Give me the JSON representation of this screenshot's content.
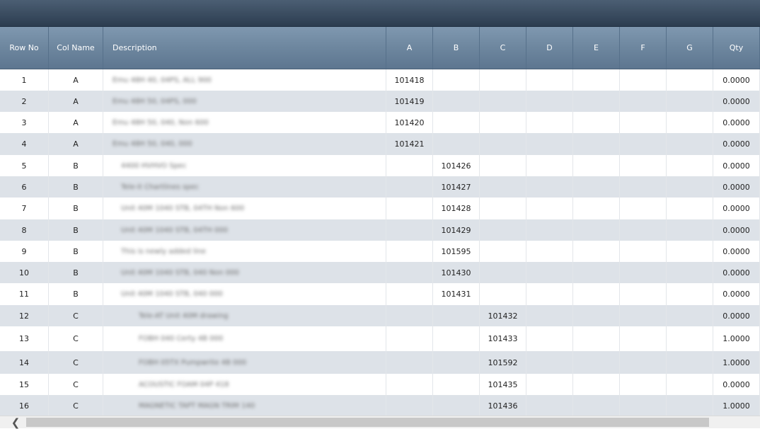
{
  "grid": {
    "columns": [
      {
        "key": "row_no",
        "label": "Row No"
      },
      {
        "key": "col_name",
        "label": "Col Name"
      },
      {
        "key": "description",
        "label": "Description"
      },
      {
        "key": "a",
        "label": "A"
      },
      {
        "key": "b",
        "label": "B"
      },
      {
        "key": "c",
        "label": "C"
      },
      {
        "key": "d",
        "label": "D"
      },
      {
        "key": "e",
        "label": "E"
      },
      {
        "key": "f",
        "label": "F"
      },
      {
        "key": "g",
        "label": "G"
      },
      {
        "key": "qty",
        "label": "Qty"
      }
    ],
    "rows": [
      {
        "row_no": "1",
        "col_name": "A",
        "description": "Emu 48H 40, 04PS, ALL 900",
        "a": "101418",
        "b": "",
        "c": "",
        "qty": "0.0000"
      },
      {
        "row_no": "2",
        "col_name": "A",
        "description": "Emu 48H 50, 04PS, 000",
        "a": "101419",
        "b": "",
        "c": "",
        "qty": "0.0000"
      },
      {
        "row_no": "3",
        "col_name": "A",
        "description": "Emu 48H 50, 040, Non 600",
        "a": "101420",
        "b": "",
        "c": "",
        "qty": "0.0000"
      },
      {
        "row_no": "4",
        "col_name": "A",
        "description": "Emu 48H 50, 040, 000",
        "a": "101421",
        "b": "",
        "c": "",
        "qty": "0.0000"
      },
      {
        "row_no": "5",
        "col_name": "B",
        "description": "4400 HVHVO Spec",
        "a": "",
        "b": "101426",
        "c": "",
        "qty": "0.0000"
      },
      {
        "row_no": "6",
        "col_name": "B",
        "description": "Tele-it Chartlines spec",
        "a": "",
        "b": "101427",
        "c": "",
        "qty": "0.0000"
      },
      {
        "row_no": "7",
        "col_name": "B",
        "description": "Unit 40M 1040 STB, 04TH Non 600",
        "a": "",
        "b": "101428",
        "c": "",
        "qty": "0.0000"
      },
      {
        "row_no": "8",
        "col_name": "B",
        "description": "Unit 40M 1040 STB, 04TH 000",
        "a": "",
        "b": "101429",
        "c": "",
        "qty": "0.0000"
      },
      {
        "row_no": "9",
        "col_name": "B",
        "description": "This is newly added line",
        "a": "",
        "b": "101595",
        "c": "",
        "qty": "0.0000"
      },
      {
        "row_no": "10",
        "col_name": "B",
        "description": "Unit 40M 1040 STB, 040 Non 000",
        "a": "",
        "b": "101430",
        "c": "",
        "qty": "0.0000"
      },
      {
        "row_no": "11",
        "col_name": "B",
        "description": "Unit 40M 1040 STB, 040 000",
        "a": "",
        "b": "101431",
        "c": "",
        "qty": "0.0000"
      },
      {
        "row_no": "12",
        "col_name": "C",
        "description": "Tele-AT Unit 40M drawing",
        "a": "",
        "b": "",
        "c": "101432",
        "qty": "0.0000"
      },
      {
        "row_no": "13",
        "col_name": "C",
        "description": "FOBH 040 Certy 4B 000",
        "a": "",
        "b": "",
        "c": "101433",
        "qty": "1.0000"
      },
      {
        "row_no": "14",
        "col_name": "C",
        "description": "FOBH 05TX Pumpwrite 4B 000",
        "a": "",
        "b": "",
        "c": "101592",
        "qty": "1.0000"
      },
      {
        "row_no": "15",
        "col_name": "C",
        "description": "ACOUSTIC FOAM 04P 418",
        "a": "",
        "b": "",
        "c": "101435",
        "qty": "0.0000"
      },
      {
        "row_no": "16",
        "col_name": "C",
        "description": "MAGNETIC TAPT MAGN TRIM 140",
        "a": "",
        "b": "",
        "c": "101436",
        "qty": "1.0000"
      }
    ]
  },
  "scrollbar": {
    "left_arrow": "❮"
  }
}
